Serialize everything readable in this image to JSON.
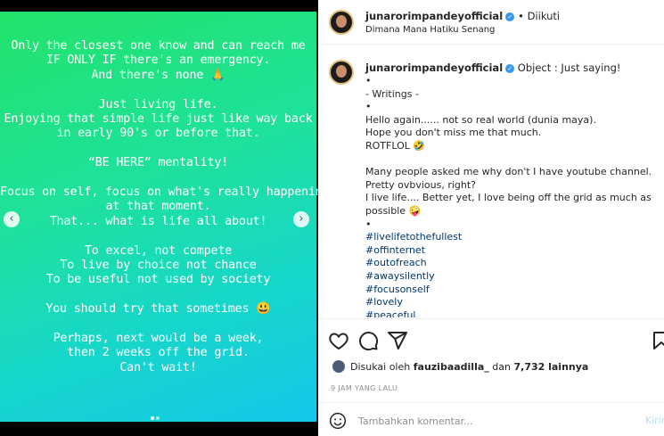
{
  "story": {
    "lines": [
      "Only the closest one know and can reach me",
      "IF ONLY IF there's an emergency.",
      "And there's none 🙏",
      "",
      "Just living life.",
      "Enjoying that simple life just like way back",
      "in early 90's or before that.",
      "",
      "“BE HERE” mentality!",
      "",
      "Focus on self, focus on what's really happening",
      "at that moment.",
      "That... what is life all about!",
      "",
      "To excel, not compete",
      "To live by choice not chance",
      "To be useful not used by society",
      "",
      "You should try that sometimes 😃",
      "",
      "Perhaps, next would be a week,",
      "then 2 weeks off the grid.",
      "Can't wait!"
    ],
    "prev_icon": "chevron-left-icon",
    "next_icon": "chevron-right-icon",
    "prev_glyph": "‹",
    "next_glyph": "›"
  },
  "header": {
    "username": "junarorimpandeyofficial",
    "follow_status": "• Diikuti",
    "location": "Dimana Mana Hatiku Senang"
  },
  "caption": {
    "username": "junarorimpandeyofficial",
    "title": "Object : Just saying!",
    "lines": [
      {
        "text": "•",
        "tag": false
      },
      {
        "text": "- Writings -",
        "tag": false
      },
      {
        "text": "•",
        "tag": false
      },
      {
        "text": "Hello again...... not so real world (dunia maya).",
        "tag": false
      },
      {
        "text": "Hope you don't miss me that much.",
        "tag": false
      },
      {
        "text": "ROTFLOL 🤣",
        "tag": false
      },
      {
        "text": "",
        "tag": false
      },
      {
        "text": "Many people asked me why don't I have youtube channel.",
        "tag": false
      },
      {
        "text": "Pretty ovbvious, right?",
        "tag": false
      },
      {
        "text": "I live life.... Better yet, I love being off the grid as much as",
        "tag": false
      },
      {
        "text": "possible 🤪",
        "tag": false
      },
      {
        "text": "•",
        "tag": false
      },
      {
        "text": "#livelifetothefullest",
        "tag": true
      },
      {
        "text": "#offinternet",
        "tag": true
      },
      {
        "text": "#outofreach",
        "tag": true
      },
      {
        "text": "#awaysilently",
        "tag": true
      },
      {
        "text": "#focusonself",
        "tag": true
      },
      {
        "text": "#lovely",
        "tag": true
      },
      {
        "text": "#peaceful",
        "tag": true
      }
    ]
  },
  "likes": {
    "prefix": "Disukai oleh",
    "user": "fauzibaadilla_",
    "middle": "dan",
    "count": "7,732 lainnya"
  },
  "timestamp": "9 JAM YANG LALU",
  "comment": {
    "placeholder": "Tambahkan komentar...",
    "post_label": "Kirim"
  },
  "colors": {
    "gradient_start": "#22e36a",
    "gradient_end": "#13c7ea",
    "verified": "#3897f0",
    "hashtag": "#00376b",
    "post_disabled": "#b2dffc"
  }
}
